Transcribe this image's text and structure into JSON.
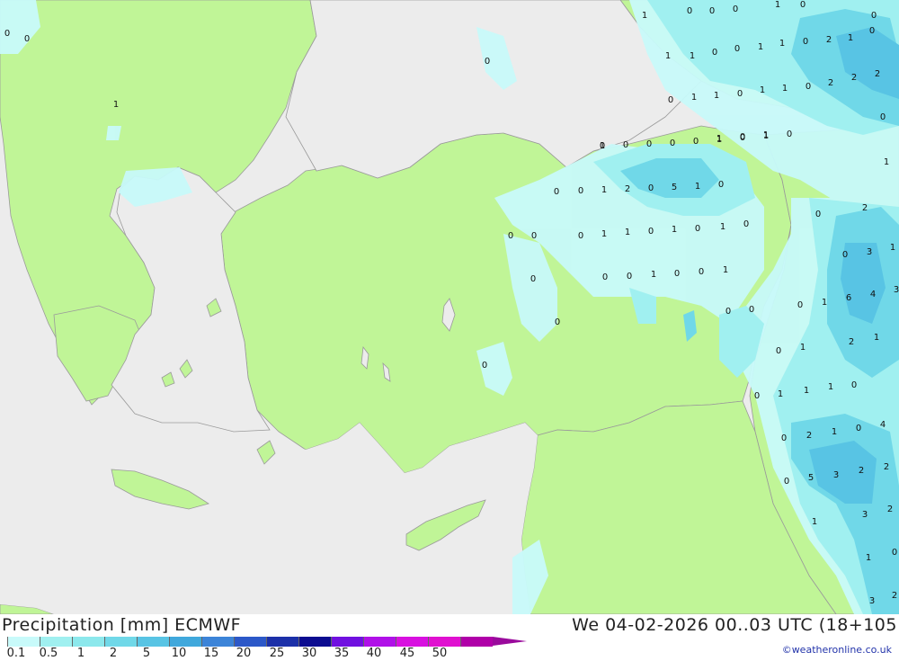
{
  "legend": {
    "title": "Precipitation [mm]  ECMWF",
    "datetime": "We 04-02-2026 00..03 UTC (18+105",
    "credit": "©weatheronline.co.uk",
    "scale_labels": [
      "0.1",
      "0.5",
      "1",
      "2",
      "5",
      "10",
      "15",
      "20",
      "25",
      "30",
      "35",
      "40",
      "45",
      "50"
    ],
    "scale_colors": [
      "#c8fafa",
      "#a0f0f0",
      "#8ce8ec",
      "#70d8e8",
      "#58c4e4",
      "#40a8dc",
      "#3c84d8",
      "#2c58c8",
      "#1c30a8",
      "#0c0c90",
      "#7010e0",
      "#b010e8",
      "#d810e0",
      "#e010d0",
      "#b000a8"
    ],
    "tip_color": "#9a0a9c"
  },
  "map": {
    "land_color": "#c0f597",
    "sea_color": "#ececec",
    "border_color": "#9a9a9a",
    "precip_light_color": "#c8fafa",
    "precip_mid_color": "#a0f0f0",
    "precip_heavy_color": "#58c4e4",
    "precip_values": [
      {
        "v": "1"
      },
      {
        "v": "0"
      },
      {
        "v": "0"
      },
      {
        "v": "0"
      },
      {
        "v": "1"
      },
      {
        "v": "0"
      },
      {
        "v": "0"
      },
      {
        "v": "0"
      },
      {
        "v": "0"
      },
      {
        "v": "1"
      },
      {
        "v": "0"
      },
      {
        "v": "1"
      },
      {
        "v": "1"
      },
      {
        "v": "0"
      },
      {
        "v": "0"
      },
      {
        "v": "1"
      },
      {
        "v": "1"
      },
      {
        "v": "0"
      },
      {
        "v": "2"
      },
      {
        "v": "1"
      },
      {
        "v": "0"
      },
      {
        "v": "0"
      },
      {
        "v": "1"
      },
      {
        "v": "1"
      },
      {
        "v": "0"
      },
      {
        "v": "1"
      },
      {
        "v": "1"
      },
      {
        "v": "0"
      },
      {
        "v": "2"
      },
      {
        "v": "2"
      },
      {
        "v": "2"
      },
      {
        "v": "0"
      },
      {
        "v": "1"
      },
      {
        "v": "0"
      },
      {
        "v": "1"
      },
      {
        "v": "1"
      },
      {
        "v": "0"
      },
      {
        "v": "1"
      },
      {
        "v": "0"
      },
      {
        "v": "0"
      },
      {
        "v": "0"
      },
      {
        "v": "0"
      },
      {
        "v": "1"
      },
      {
        "v": "0"
      },
      {
        "v": "1"
      },
      {
        "v": "0"
      },
      {
        "v": "0"
      },
      {
        "v": "0"
      },
      {
        "v": "1"
      },
      {
        "v": "2"
      },
      {
        "v": "0"
      },
      {
        "v": "5"
      },
      {
        "v": "1"
      },
      {
        "v": "0"
      },
      {
        "v": "0"
      },
      {
        "v": "0"
      },
      {
        "v": "0"
      },
      {
        "v": "1"
      },
      {
        "v": "1"
      },
      {
        "v": "0"
      },
      {
        "v": "1"
      },
      {
        "v": "0"
      },
      {
        "v": "1"
      },
      {
        "v": "0"
      },
      {
        "v": "0"
      },
      {
        "v": "0"
      },
      {
        "v": "1"
      },
      {
        "v": "0"
      },
      {
        "v": "0"
      },
      {
        "v": "1"
      },
      {
        "v": "0"
      },
      {
        "v": "0"
      },
      {
        "v": "0"
      },
      {
        "v": "0"
      },
      {
        "v": "0"
      },
      {
        "v": "0"
      },
      {
        "v": "2"
      },
      {
        "v": "0"
      },
      {
        "v": "3"
      },
      {
        "v": "1"
      },
      {
        "v": "0"
      },
      {
        "v": "1"
      },
      {
        "v": "6"
      },
      {
        "v": "4"
      },
      {
        "v": "3"
      },
      {
        "v": "2"
      },
      {
        "v": "1"
      },
      {
        "v": "0"
      },
      {
        "v": "1"
      },
      {
        "v": "0"
      },
      {
        "v": "1"
      },
      {
        "v": "1"
      },
      {
        "v": "1"
      },
      {
        "v": "0"
      },
      {
        "v": "0"
      },
      {
        "v": "2"
      },
      {
        "v": "1"
      },
      {
        "v": "0"
      },
      {
        "v": "4"
      },
      {
        "v": "0"
      },
      {
        "v": "5"
      },
      {
        "v": "3"
      },
      {
        "v": "2"
      },
      {
        "v": "2"
      },
      {
        "v": "1"
      },
      {
        "v": "3"
      },
      {
        "v": "2"
      },
      {
        "v": "1"
      },
      {
        "v": "0"
      },
      {
        "v": "3"
      },
      {
        "v": "2"
      }
    ]
  }
}
